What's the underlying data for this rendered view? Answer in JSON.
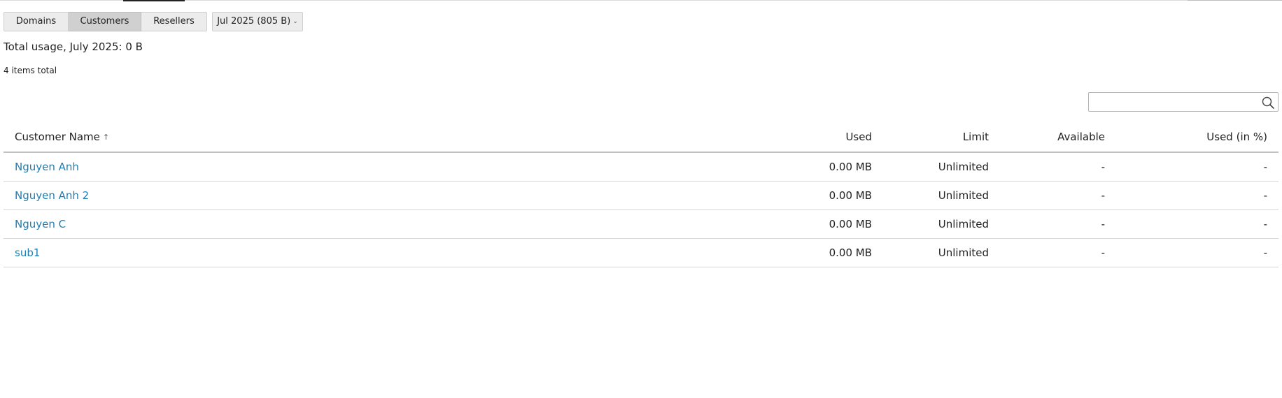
{
  "tabs": [
    {
      "label": "Domains"
    },
    {
      "label": "Customers",
      "active": true
    },
    {
      "label": "Resellers"
    }
  ],
  "period": {
    "label": "Jul 2025 (805 B)",
    "caret": "⌄"
  },
  "summary": {
    "total_usage": "Total usage, July 2025: 0 B",
    "items_total": "4 items total"
  },
  "search": {
    "value": "",
    "placeholder": "",
    "icon": "search-icon"
  },
  "table": {
    "columns": {
      "name": "Customer Name",
      "sort_indicator": "↑",
      "used": "Used",
      "limit": "Limit",
      "available": "Available",
      "used_percent": "Used (in %)"
    },
    "rows": [
      {
        "name": "Nguyen Anh",
        "used": "0.00 MB",
        "limit": "Unlimited",
        "available": "-",
        "used_percent": "-"
      },
      {
        "name": "Nguyen Anh 2",
        "used": "0.00 MB",
        "limit": "Unlimited",
        "available": "-",
        "used_percent": "-"
      },
      {
        "name": "Nguyen C",
        "used": "0.00 MB",
        "limit": "Unlimited",
        "available": "-",
        "used_percent": "-"
      },
      {
        "name": "sub1",
        "used": "0.00 MB",
        "limit": "Unlimited",
        "available": "-",
        "used_percent": "-"
      }
    ]
  },
  "colors": {
    "link": "#1e7eb3",
    "active_tab": "#d0d0d0",
    "tab": "#ececec",
    "text": "#222222"
  }
}
